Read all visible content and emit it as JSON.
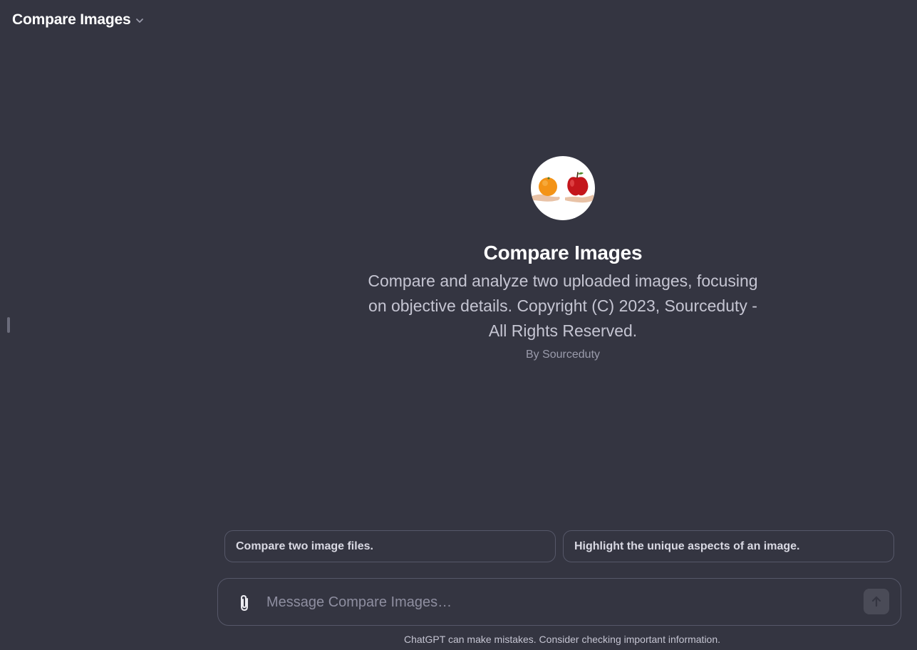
{
  "header": {
    "title": "Compare Images",
    "dropdown_icon": "chevron-down-icon"
  },
  "gpt": {
    "avatar_icon": "orange-and-apple-avatar",
    "title": "Compare Images",
    "description": "Compare and analyze two uploaded images, focusing on objective details. Copyright (C) 2023, Sourceduty - All Rights Reserved.",
    "author": "By Sourceduty"
  },
  "suggestions": [
    {
      "label": "Compare two image files."
    },
    {
      "label": "Highlight the unique aspects of an image."
    }
  ],
  "composer": {
    "placeholder": "Message Compare Images…",
    "value": "",
    "attach_icon": "paperclip-icon",
    "send_icon": "arrow-up-icon"
  },
  "footer": {
    "note": "ChatGPT can make mistakes. Consider checking important information."
  },
  "colors": {
    "background": "#343541",
    "border": "#565869",
    "send_button": "#4a4b57"
  }
}
